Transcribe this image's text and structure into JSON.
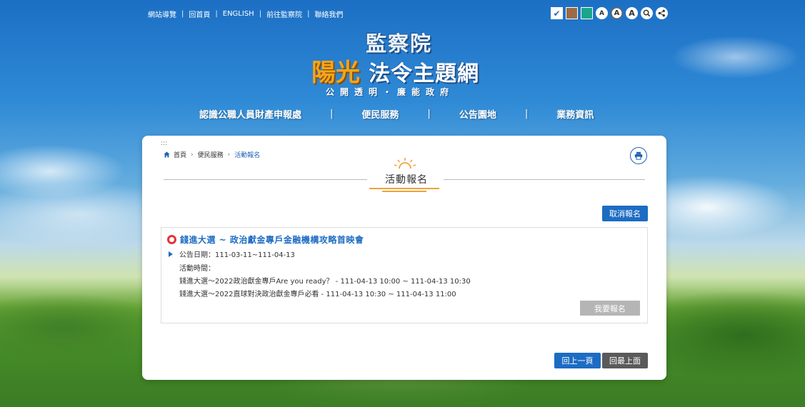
{
  "toplinks": [
    "網站導覽",
    "回首頁",
    "ENGLISH",
    "前往監察院",
    "聯絡我們"
  ],
  "toolbar": {
    "themes": [
      {
        "icon": "check-theme-icon",
        "color": "#2d6cb5",
        "glyph": "✔"
      },
      {
        "icon": "brown-theme-swatch",
        "color": "#9c6a45",
        "glyph": ""
      },
      {
        "icon": "green-theme-swatch",
        "color": "#1aa58a",
        "glyph": ""
      }
    ],
    "font_size_glyph": "A",
    "icons": [
      "font-small-icon",
      "font-medium-icon",
      "font-large-icon",
      "search-icon",
      "share-icon"
    ]
  },
  "logo": {
    "org": "監察院",
    "sun": "陽光",
    "topic": "法令主題網",
    "slogan": "公開透明・廉能政府"
  },
  "nav": [
    "認識公職人員財產申報處",
    "便民服務",
    "公告園地",
    "業務資訊"
  ],
  "nav_separator": "|",
  "breadcrumb": {
    "dots": ":::",
    "items": [
      "首頁",
      "便民服務",
      "活動報名"
    ],
    "chevron": "›"
  },
  "page_title": "活動報名",
  "cancel_label": "取消報名",
  "event": {
    "title": "錢進大選 ~ 政治獻金專戶金融機構攻略首映會",
    "date_line": "公告日期：111-03-11~111-04-13",
    "time_label": "活動時間：",
    "sessions": [
      "錢進大選～2022政治獻金專戶Are you ready？ - 111-04-13 10:00 ~ 111-04-13 10:30",
      "錢進大選～2022直球對決政治獻金專戶必看 - 111-04-13 10:30 ~ 111-04-13 11:00"
    ],
    "signup_label": "我要報名"
  },
  "back_label": "回上一頁",
  "top_label": "回最上面",
  "colors": {
    "accent": "#1d6cc3",
    "title_underline": "#f0a33a",
    "ring": "#e0353a",
    "disabled_button": "#b5b5b5",
    "dark_button": "#5a5a5a"
  }
}
